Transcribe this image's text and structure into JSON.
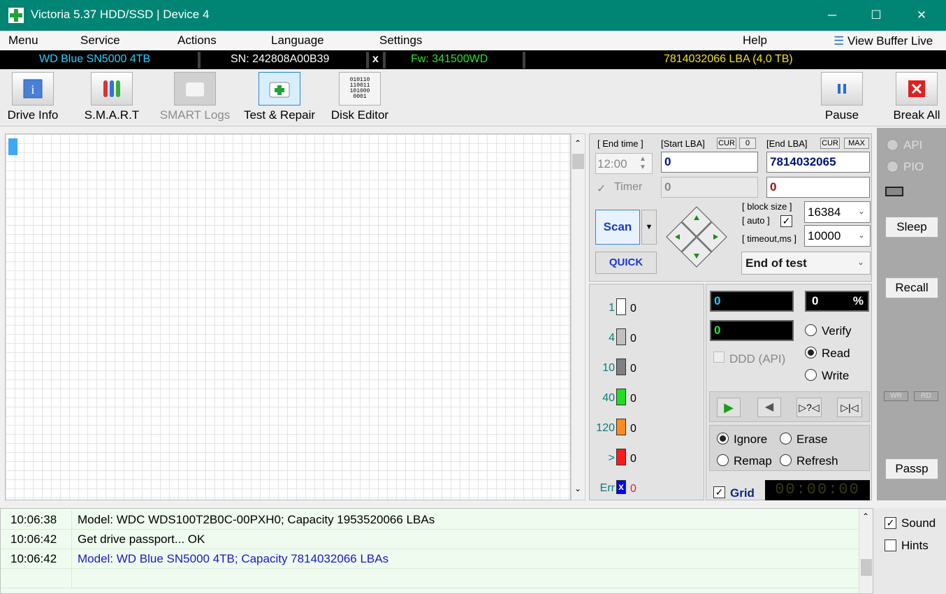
{
  "window": {
    "title": "Victoria 5.37 HDD/SSD | Device 4",
    "minimize": "─",
    "maximize": "☐",
    "close": "✕"
  },
  "menu": {
    "items": [
      "Menu",
      "Service",
      "Actions",
      "Language",
      "Settings",
      "Help"
    ],
    "view_buffer": "View Buffer Live"
  },
  "infobar": {
    "model": "WD Blue SN5000 4TB",
    "serial": "SN: 242808A00B39",
    "close": "x",
    "firmware": "Fw: 341500WD",
    "capacity": "7814032066 LBA (4,0 TB)"
  },
  "toolbar": {
    "drive_info": "Drive Info",
    "smart": "S.M.A.R.T",
    "smart_logs": "SMART Logs",
    "test_repair": "Test & Repair",
    "disk_editor": "Disk Editor",
    "pause": "Pause",
    "break_all": "Break All",
    "binary_art": [
      "010110",
      "110011",
      "101000",
      "0001"
    ]
  },
  "scan": {
    "end_time_label": "[ End time ]",
    "start_lba_label": "[Start LBA]",
    "cur": "CUR",
    "zero": "0",
    "end_lba_label": "[End LBA]",
    "max": "MAX",
    "end_time_value": "12:00",
    "start_lba": "0",
    "end_lba": "7814032065",
    "timer_label": "Timer",
    "start_lba2": "0",
    "end_lba2": "0",
    "scan_button": "Scan",
    "quick_button": "QUICK",
    "block_size_label": "[ block size ]",
    "auto_label": "[ auto ]",
    "block_size": "16384",
    "timeout_label": "[ timeout,ms ]",
    "timeout": "10000",
    "end_of_test": "End of test"
  },
  "legend": {
    "rows": [
      {
        "label": "1",
        "count": "0",
        "color": "#ffffff"
      },
      {
        "label": "4",
        "count": "0",
        "color": "#c0c0c0"
      },
      {
        "label": "10",
        "count": "0",
        "color": "#808080"
      },
      {
        "label": "40",
        "count": "0",
        "color": "#22dd22"
      },
      {
        "label": "120",
        "count": "0",
        "color": "#ff8c1a"
      },
      {
        "label": ">",
        "count": "0",
        "color": "#ff1a1a"
      },
      {
        "label": "Err",
        "count": "0",
        "color": "#0000ff"
      }
    ],
    "err_mark": "x"
  },
  "stats": {
    "counter1": "0",
    "percent_value": "0",
    "percent_sign": "%",
    "counter2": "0",
    "ddd_label": "DDD (API)",
    "verify": "Verify",
    "read": "Read",
    "write": "Write",
    "ignore": "Ignore",
    "erase": "Erase",
    "remap": "Remap",
    "refresh": "Refresh",
    "grid_label": "Grid",
    "timer_display": "00:00:00"
  },
  "transport": {
    "play": "▶",
    "back": "◀",
    "query": "▷?◁",
    "end": "▷|◁"
  },
  "side": {
    "api": "API",
    "pio": "PIO",
    "sleep": "Sleep",
    "recall": "Recall",
    "wr": "WR",
    "rd": "RD",
    "passp": "Passp",
    "sound": "Sound",
    "hints": "Hints"
  },
  "log": {
    "entries": [
      {
        "time": "10:06:38",
        "msg": "Model: WDC WDS100T2B0C-00PXH0; Capacity 1953520066 LBAs",
        "color": "#000000"
      },
      {
        "time": "10:06:42",
        "msg": "Get drive passport... OK",
        "color": "#000000"
      },
      {
        "time": "10:06:42",
        "msg": "Model: WD Blue SN5000 4TB; Capacity 7814032066 LBAs",
        "color": "#1a1acc"
      }
    ]
  }
}
